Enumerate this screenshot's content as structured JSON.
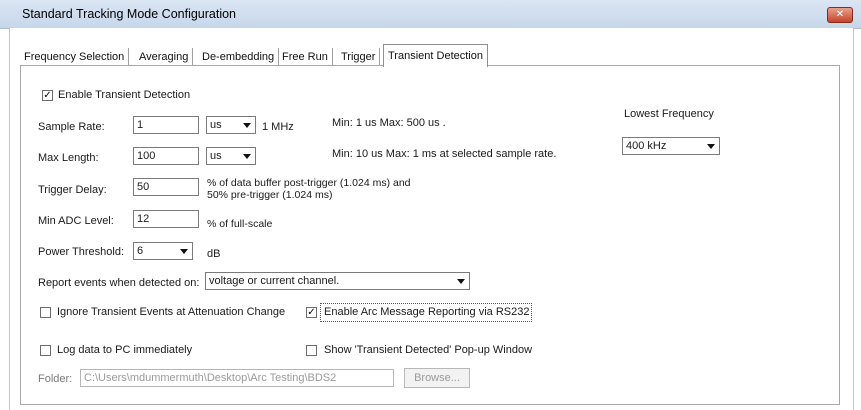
{
  "window": {
    "title": "Standard Tracking Mode Configuration",
    "close_icon": "✕"
  },
  "tabs": [
    {
      "label": "Frequency Selection"
    },
    {
      "label": "Averaging"
    },
    {
      "label": "De-embedding"
    },
    {
      "label": "Free Run"
    },
    {
      "label": "Trigger"
    },
    {
      "label": "Transient Detection"
    }
  ],
  "enable_transient": {
    "label": "Enable Transient Detection",
    "checked": true
  },
  "sample_rate": {
    "label": "Sample Rate:",
    "value": "1",
    "unit": "us",
    "freq": "1 MHz",
    "note": "Min: 1 us  Max: 500 us ."
  },
  "max_length": {
    "label": "Max Length:",
    "value": "100",
    "unit": "us",
    "note": "Min: 10 us  Max: 1 ms  at selected sample rate."
  },
  "trigger_delay": {
    "label": "Trigger Delay:",
    "value": "50",
    "note_line1": "% of data buffer post-trigger (1.024 ms) and",
    "note_line2": "50% pre-trigger (1.024 ms)"
  },
  "min_adc": {
    "label": "Min ADC Level:",
    "value": "12",
    "note": "% of full-scale"
  },
  "power_threshold": {
    "label": "Power Threshold:",
    "value": "6",
    "unit": "dB"
  },
  "lowest_frequency": {
    "label": "Lowest Frequency",
    "value": "400 kHz"
  },
  "report_events": {
    "label": "Report events when detected on:",
    "value": "voltage or current channel."
  },
  "ignore_transient": {
    "label": "Ignore Transient Events at Attenuation Change",
    "checked": false
  },
  "enable_arc": {
    "label": "Enable Arc Message Reporting via RS232",
    "checked": true
  },
  "log_data": {
    "label": "Log data to PC immediately",
    "checked": false
  },
  "show_popup": {
    "label": "Show 'Transient Detected' Pop-up Window",
    "checked": false
  },
  "folder": {
    "label": "Folder:",
    "value": "C:\\Users\\mdummermuth\\Desktop\\Arc Testing\\BDS2",
    "browse_label": "Browse..."
  },
  "check_mark": "✓"
}
